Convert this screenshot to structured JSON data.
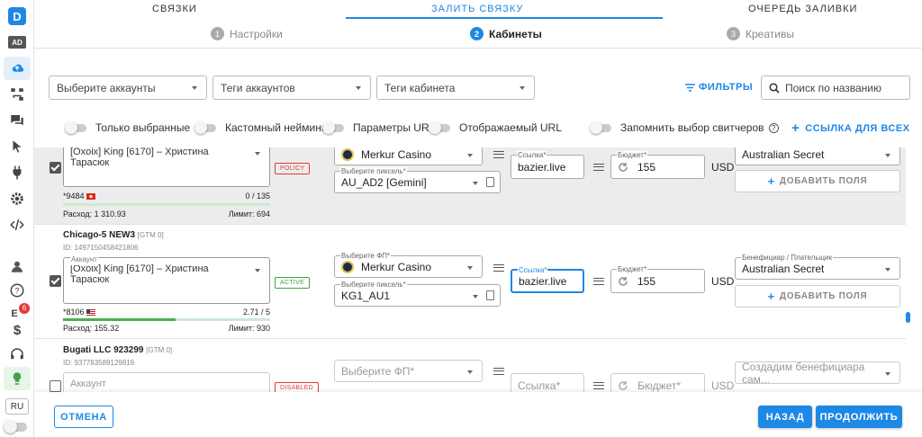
{
  "sidebar": {
    "logo": "D",
    "ad_label": "AD",
    "notification_count": "6",
    "lang": "RU"
  },
  "tabs": [
    "СВЯЗКИ",
    "ЗАЛИТЬ СВЯЗКУ",
    "ОЧЕРЕДЬ ЗАЛИВКИ"
  ],
  "steps": [
    {
      "num": "1",
      "label": "Настройки"
    },
    {
      "num": "2",
      "label": "Кабинеты"
    },
    {
      "num": "3",
      "label": "Креативы"
    }
  ],
  "filters": {
    "accounts_select": "Выберите аккаунты",
    "account_tags": "Теги аккаунтов",
    "cabinet_tags": "Теги кабинета",
    "filters_button": "ФИЛЬТРЫ",
    "search_placeholder": "Поиск по названию"
  },
  "switches": {
    "only_selected": "Только выбранные",
    "custom_naming": "Кастомный нейминг",
    "url_params": "Параметры URL",
    "display_url": "Отображаемый URL",
    "remember_switchers": "Запомнить выбор свитчеров",
    "add_link_all": "ССЫЛКА ДЛЯ ВСЕХ"
  },
  "rows": [
    {
      "account_label": "Аккаунт",
      "account_value": "[Oxoix] King [6170] – Христина Тарасюк",
      "account_suffix": "*9484",
      "count": "0 / 135",
      "spend": "Расход: 1 310.93",
      "limit": "Лимит: 694",
      "status": "POLICY",
      "fp_label": "Выберите ФП*",
      "fp_value": "Merkur Casino",
      "pixel_label": "Выберите пиксель*",
      "pixel_value": "AU_AD2 [Gemini]",
      "link_label": "Ссылка*",
      "link_value": "bazier.live",
      "budget_label": "Бюджет*",
      "budget_value": "155",
      "currency": "USD",
      "beneficiary_label": "Бенефициар / Плательщик",
      "beneficiary_value": "Australian Secret",
      "add_fields": "ДОБАВИТЬ ПОЛЯ",
      "progress": 0.0
    },
    {
      "title": "Chicago-5 NEW3",
      "tag": "[GTM 0]",
      "id": "ID: 1497150458421806",
      "account_label": "Аккаунт",
      "account_value": "[Oxoix] King [6170] – Христина Тарасюк",
      "account_suffix": "*8106",
      "count": "2.71 / 5",
      "spend": "Расход: 155.32",
      "limit": "Лимит: 930",
      "status": "ACTIVE",
      "fp_label": "Выберите ФП*",
      "fp_value": "Merkur Casino",
      "pixel_label": "Выберите пиксель*",
      "pixel_value": "KG1_AU1",
      "link_label": "Ссылка*",
      "link_value": "bazier.live",
      "budget_label": "Бюджет*",
      "budget_value": "155",
      "currency": "USD",
      "beneficiary_label": "Бенефициар / Плательщик",
      "beneficiary_value": "Australian Secret",
      "add_fields": "ДОБАВИТЬ ПОЛЯ",
      "progress": 0.542
    },
    {
      "title": "Bugati LLC 923299",
      "tag": "[GTM 0]",
      "id": "ID: 937783589129816",
      "account_placeholder": "Аккаунт",
      "status": "DISABLED",
      "fp_placeholder": "Выберите ФП*",
      "link_placeholder": "Ссылка*",
      "budget_placeholder": "Бюджет*",
      "currency": "USD",
      "beneficiary_placeholder": "Создадим бенефициара сам..."
    }
  ],
  "bottom": {
    "cancel": "ОТМЕНА",
    "back": "НАЗАД",
    "continue": "ПРОДОЛЖИТЬ"
  },
  "colors": {
    "accent": "#1e88e5",
    "active": "#43a047",
    "danger": "#e53935"
  }
}
